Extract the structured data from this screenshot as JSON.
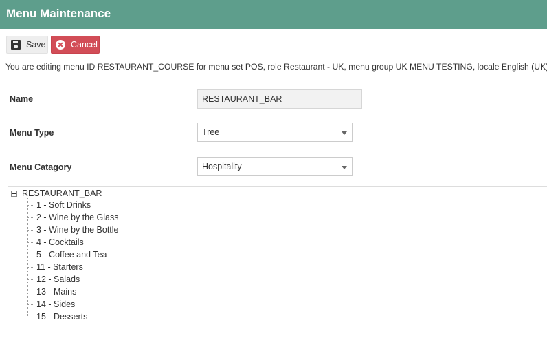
{
  "header": {
    "title": "Menu Maintenance"
  },
  "toolbar": {
    "save_label": "Save",
    "cancel_label": "Cancel"
  },
  "info_text": "You are editing menu ID RESTAURANT_COURSE for menu set POS, role Restaurant - UK, menu group UK MENU TESTING, locale English (UK)",
  "form": {
    "name_label": "Name",
    "name_value": "RESTAURANT_BAR",
    "menu_type_label": "Menu Type",
    "menu_type_value": "Tree",
    "menu_category_label": "Menu Catagory",
    "menu_category_value": "Hospitality"
  },
  "tree": {
    "root": "RESTAURANT_BAR",
    "items": [
      "1 - Soft Drinks",
      "2 - Wine by the Glass",
      "3 - Wine by the Bottle",
      "4 - Cocktails",
      "5 - Coffee and Tea",
      "11 - Starters",
      "12 - Salads",
      "13 - Mains",
      "14 - Sides",
      "15 - Desserts"
    ]
  },
  "icons": {
    "save": "floppy-disk-icon",
    "cancel": "x-circle-icon",
    "expander": "collapse-minus-icon",
    "select": "chevron-down-icon"
  },
  "colors": {
    "header_bg": "#5e9e8c",
    "cancel_bg": "#d24d57",
    "save_bg": "#eeeeee"
  }
}
